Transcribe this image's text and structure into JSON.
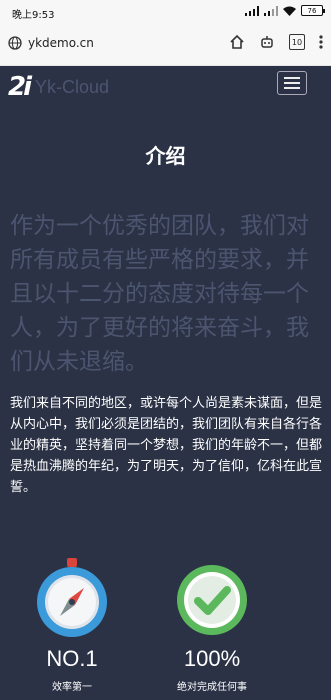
{
  "status_bar": {
    "time": "晚上9:53",
    "battery": "76"
  },
  "browser": {
    "url": "ykdemo.cn",
    "tab_count": "10"
  },
  "site": {
    "logo_mark": "2i",
    "brand": "Yk-Cloud"
  },
  "section": {
    "title": "介绍",
    "lead": "作为一个优秀的团队，我们对所有成员有些严格的要求，并且以十二分的态度对待每一个人，为了更好的将来奋斗，我们从未退缩。",
    "body": "我们来自不同的地区，或许每个人尚是素未谋面，但是从内心中，我们必须是团结的，我们团队有来自各行各业的精英，坚持着同一个梦想，我们的年龄不一，但都是热血沸腾的年纪，为了明天，为了信仰，亿科在此宣誓。"
  },
  "features": [
    {
      "icon": "compass-icon",
      "value": "NO.1",
      "caption": "效率第一"
    },
    {
      "icon": "check-circle-icon",
      "value": "100%",
      "caption": "绝对完成任何事"
    }
  ],
  "colors": {
    "background": "#2b3245",
    "lead_text": "#4c5570",
    "check_green": "#5cb85c",
    "compass_blue": "#3b9ad9",
    "compass_red": "#e0473f"
  }
}
